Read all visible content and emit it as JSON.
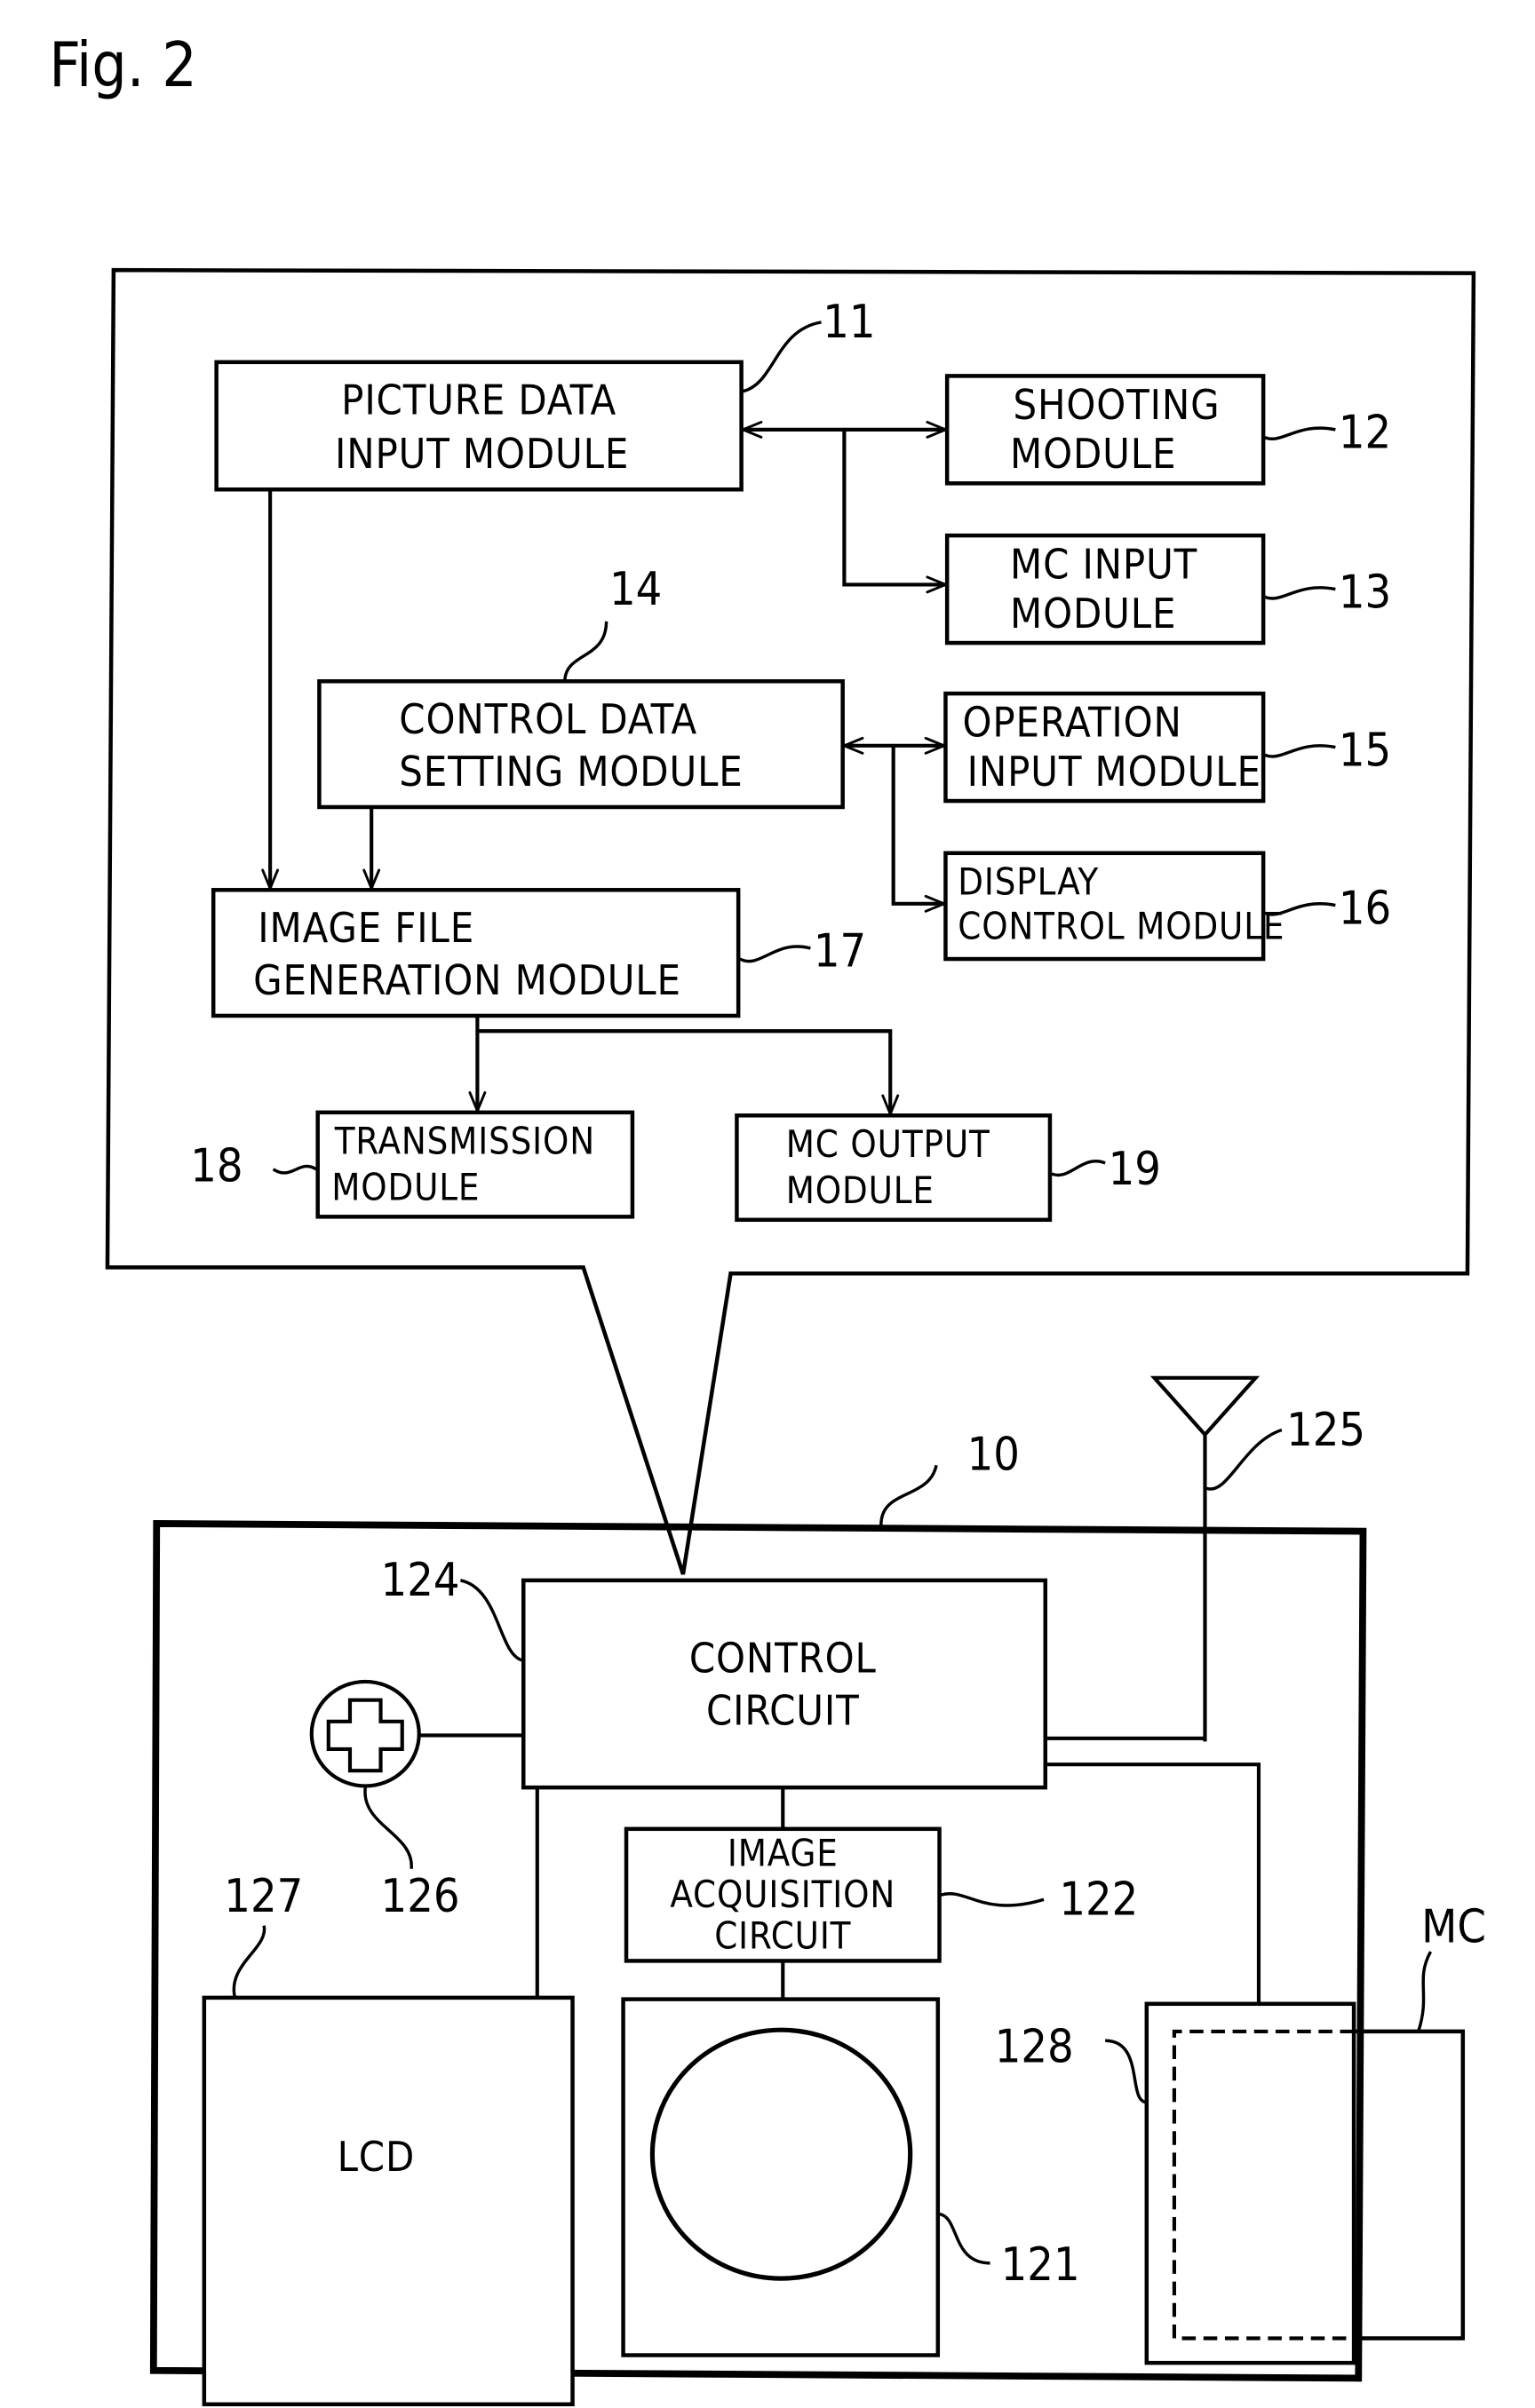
{
  "figure": {
    "title": "Fig. 2"
  },
  "software_modules": {
    "picture_data_input": {
      "lines": [
        "PICTURE DATA",
        "INPUT MODULE"
      ],
      "ref": "11"
    },
    "shooting": {
      "lines": [
        "SHOOTING",
        "MODULE"
      ],
      "ref": "12"
    },
    "mc_input": {
      "lines": [
        "MC INPUT",
        "MODULE"
      ],
      "ref": "13"
    },
    "control_data_setting": {
      "lines": [
        "CONTROL DATA",
        "SETTING MODULE"
      ],
      "ref": "14"
    },
    "operation_input": {
      "lines": [
        "OPERATION",
        "INPUT MODULE"
      ],
      "ref": "15"
    },
    "display_control": {
      "lines": [
        "DISPLAY",
        "CONTROL MODULE"
      ],
      "ref": "16"
    },
    "image_file_generation": {
      "lines": [
        "IMAGE FILE",
        "GENERATION MODULE"
      ],
      "ref": "17"
    },
    "transmission": {
      "lines": [
        "TRANSMISSION",
        "MODULE"
      ],
      "ref": "18"
    },
    "mc_output": {
      "lines": [
        "MC OUTPUT",
        "MODULE"
      ],
      "ref": "19"
    }
  },
  "device": {
    "ref": "10",
    "control_circuit": {
      "lines": [
        "CONTROL",
        "CIRCUIT"
      ],
      "ref": "124"
    },
    "image_acquisition_circuit": {
      "lines": [
        "IMAGE",
        "ACQUISITION",
        "CIRCUIT"
      ],
      "ref": "122"
    },
    "lens": {
      "ref": "121"
    },
    "antenna": {
      "ref": "125"
    },
    "dpad": {
      "ref": "126"
    },
    "lcd": {
      "label": "LCD",
      "ref": "127"
    },
    "card_slot": {
      "ref": "128"
    },
    "memory_card": {
      "label": "MC"
    }
  }
}
